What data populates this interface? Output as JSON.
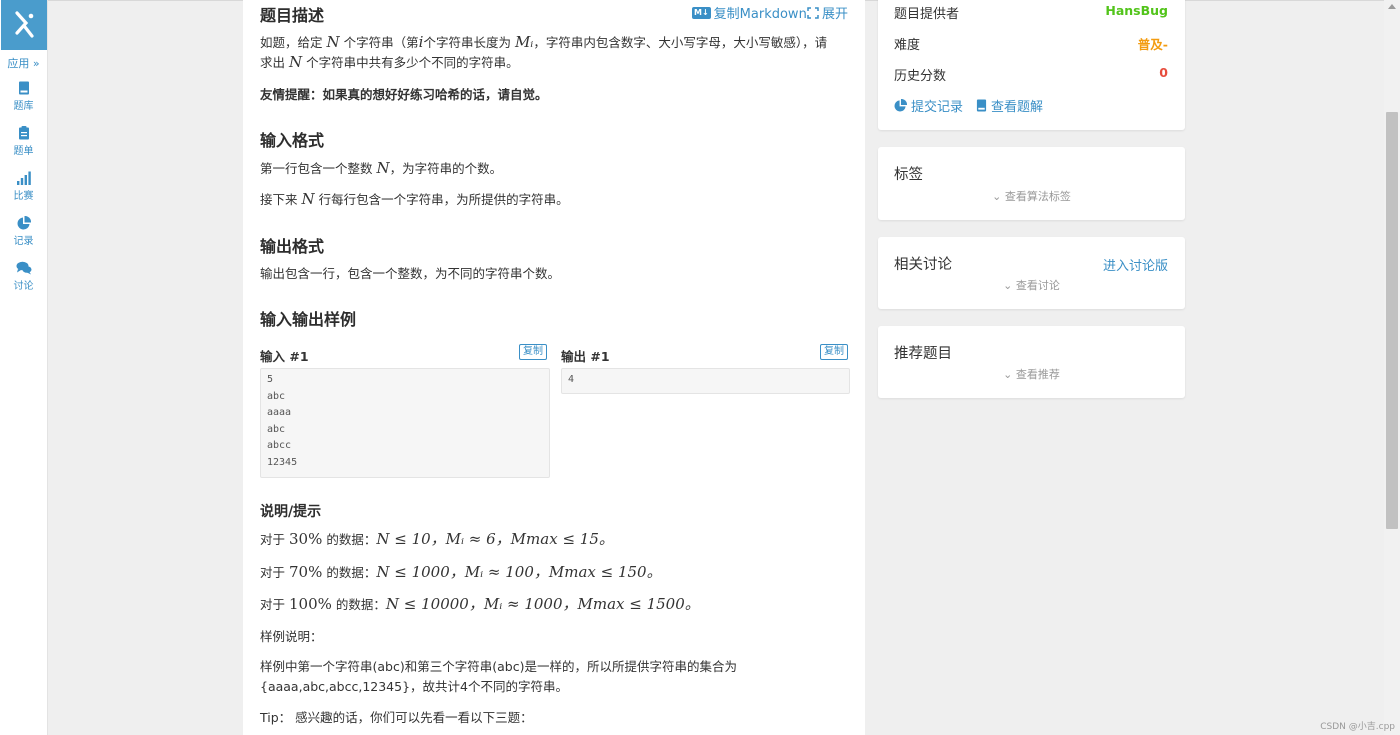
{
  "nav": {
    "app_label": "应用 »",
    "items": [
      {
        "label": "题库",
        "icon": "book-icon"
      },
      {
        "label": "题单",
        "icon": "clipboard-icon"
      },
      {
        "label": "比赛",
        "icon": "bar-chart-icon"
      },
      {
        "label": "记录",
        "icon": "pie-chart-icon"
      },
      {
        "label": "讨论",
        "icon": "chat-icon"
      }
    ]
  },
  "main": {
    "title": "题目描述",
    "copy_markdown": "复制Markdown",
    "expand": "展开",
    "desc_line1_a": "如题，给定",
    "desc_line1_b": "个字符串（第",
    "desc_line1_c": "个字符串长度为",
    "desc_line1_d": "，字符串内包含数字、大小写字母，大小写敏感），请",
    "desc_line2_a": "求出",
    "desc_line2_b": "个字符串中共有多少个不同的字符串。",
    "var_N": "N",
    "var_i": "i",
    "var_Mi": "Mᵢ",
    "tip_bold": "友情提醒：如果真的想好好练习哈希的话，请自觉。",
    "input_title": "输入格式",
    "input_line1_a": "第一行包含一个整数",
    "input_line1_b": "，为字符串的个数。",
    "input_line2_a": "接下来",
    "input_line2_b": "行每行包含一个字符串，为所提供的字符串。",
    "output_title": "输出格式",
    "output_line1": "输出包含一行，包含一个整数，为不同的字符串个数。",
    "sample_title": "输入输出样例",
    "input_label": "输入 #1",
    "output_label": "输出 #1",
    "copy_label": "复制",
    "sample_input": [
      "5",
      "abc",
      "aaaa",
      "abc",
      "abcc",
      "12345"
    ],
    "sample_output": [
      "4"
    ],
    "hint_title": "说明/提示",
    "hint1_a": "对于",
    "hint1_pct": "30%",
    "hint1_b": "的数据：",
    "hint1_math": "N ≤ 10，Mᵢ ≈ 6，Mmax ≤ 15。",
    "hint2_a": "对于",
    "hint2_pct": "70%",
    "hint2_b": "的数据：",
    "hint2_math": "N ≤ 1000，Mᵢ ≈ 100，Mmax ≤ 150。",
    "hint3_a": "对于",
    "hint3_pct": "100%",
    "hint3_b": "的数据：",
    "hint3_math": "N ≤ 10000，Mᵢ ≈ 1000，Mmax ≤ 1500。",
    "sample_explain_title": "样例说明：",
    "sample_explain_1": "样例中第一个字符串(abc)和第三个字符串(abc)是一样的，所以所提供字符串的集合为",
    "sample_explain_2": "{aaaa,abc,abcc,12345}，故共计4个不同的字符串。",
    "tip_line": "Tip：  感兴趣的话，你们可以先看一看以下三题："
  },
  "info": {
    "provider_label": "题目提供者",
    "provider_value": "HansBug",
    "difficulty_label": "难度",
    "difficulty_value": "普及-",
    "history_label": "历史分数",
    "history_value": "0",
    "submit_records": "提交记录",
    "view_solution": "查看题解"
  },
  "tags": {
    "title": "标签",
    "more": "查看算法标签"
  },
  "discussion": {
    "title": "相关讨论",
    "enter": "进入讨论版",
    "more": "查看讨论"
  },
  "recommend": {
    "title": "推荐题目",
    "more": "查看推荐"
  },
  "watermark": "CSDN @小吉.cpp",
  "colors": {
    "accent": "#3a8fc6",
    "provider_green": "#52c41a",
    "difficulty_orange": "#f39c11",
    "history_red": "#e74c3c"
  }
}
